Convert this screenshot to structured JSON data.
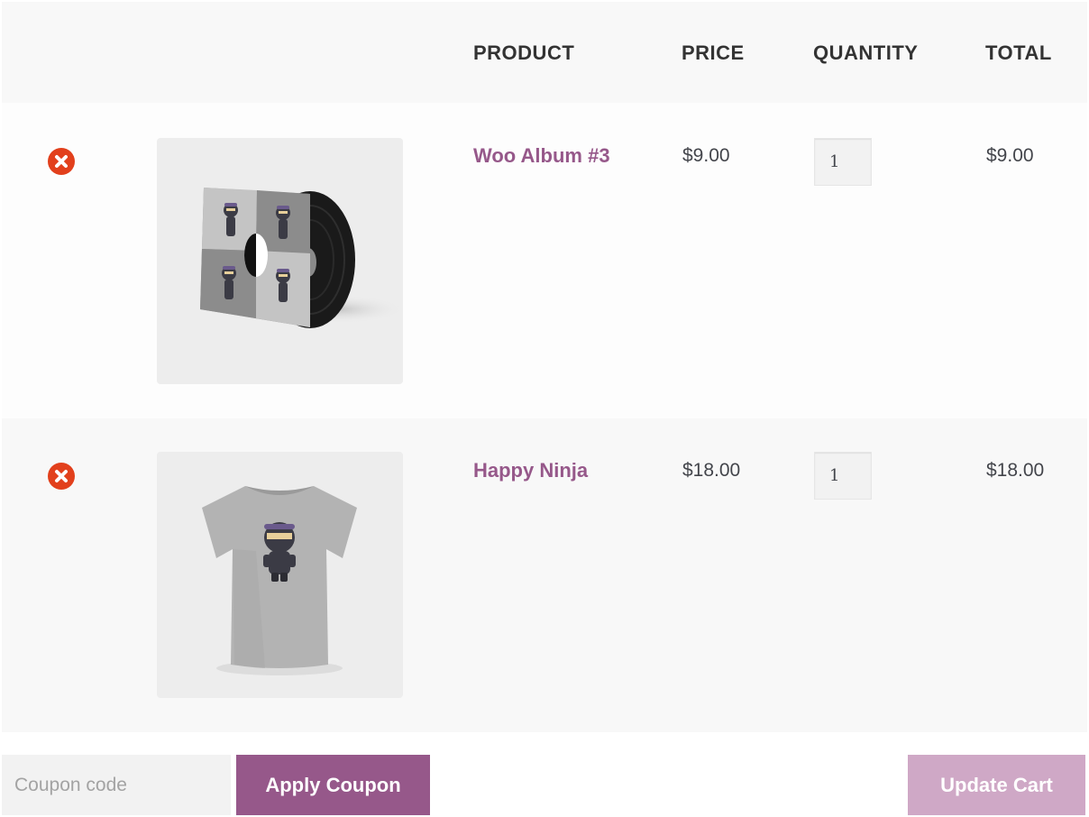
{
  "colors": {
    "accent": "#96588a",
    "accent_disabled": "#cfa8c6",
    "remove": "#e2401c",
    "header_bg": "#f8f8f8"
  },
  "table": {
    "headers": {
      "product": "PRODUCT",
      "price": "PRICE",
      "quantity": "QUANTITY",
      "total": "TOTAL"
    },
    "items": [
      {
        "name": "Woo Album #3",
        "price": "$9.00",
        "quantity": "1",
        "total": "$9.00",
        "remove_icon": "remove-circle-x-icon",
        "thumbnail": "vinyl-album-thumbnail"
      },
      {
        "name": "Happy Ninja",
        "price": "$18.00",
        "quantity": "1",
        "total": "$18.00",
        "remove_icon": "remove-circle-x-icon",
        "thumbnail": "ninja-tshirt-thumbnail"
      }
    ]
  },
  "actions": {
    "coupon_placeholder": "Coupon code",
    "coupon_value": "",
    "apply_label": "Apply Coupon",
    "update_label": "Update Cart"
  }
}
